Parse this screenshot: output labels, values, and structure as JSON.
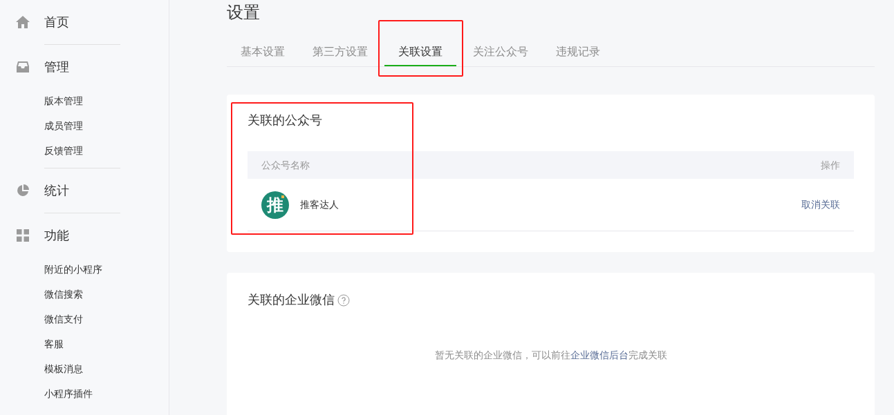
{
  "sidebar": {
    "sections": [
      {
        "label": "首页"
      },
      {
        "label": "管理",
        "items": [
          "版本管理",
          "成员管理",
          "反馈管理"
        ]
      },
      {
        "label": "统计"
      },
      {
        "label": "功能",
        "items": [
          "附近的小程序",
          "微信搜索",
          "微信支付",
          "客服",
          "模板消息",
          "小程序插件"
        ]
      }
    ]
  },
  "page_title": "设置",
  "tabs": [
    {
      "label": "基本设置",
      "selected": false,
      "highlighted": false
    },
    {
      "label": "第三方设置",
      "selected": false,
      "highlighted": false
    },
    {
      "label": "关联设置",
      "selected": true,
      "highlighted": true
    },
    {
      "label": "关注公众号",
      "selected": false,
      "highlighted": false
    },
    {
      "label": "违规记录",
      "selected": false,
      "highlighted": false
    }
  ],
  "linked_accounts": {
    "title": "关联的公众号",
    "highlighted": true,
    "columns": [
      "公众号名称",
      "操作"
    ],
    "rows": [
      {
        "avatar_text": "推",
        "name": "推客达人",
        "action": "取消关联"
      }
    ]
  },
  "linked_work_wechat": {
    "title": "关联的企业微信",
    "empty_text": "暂无关联的企业微信，可以前往**企业微信后台**完成关联"
  }
}
